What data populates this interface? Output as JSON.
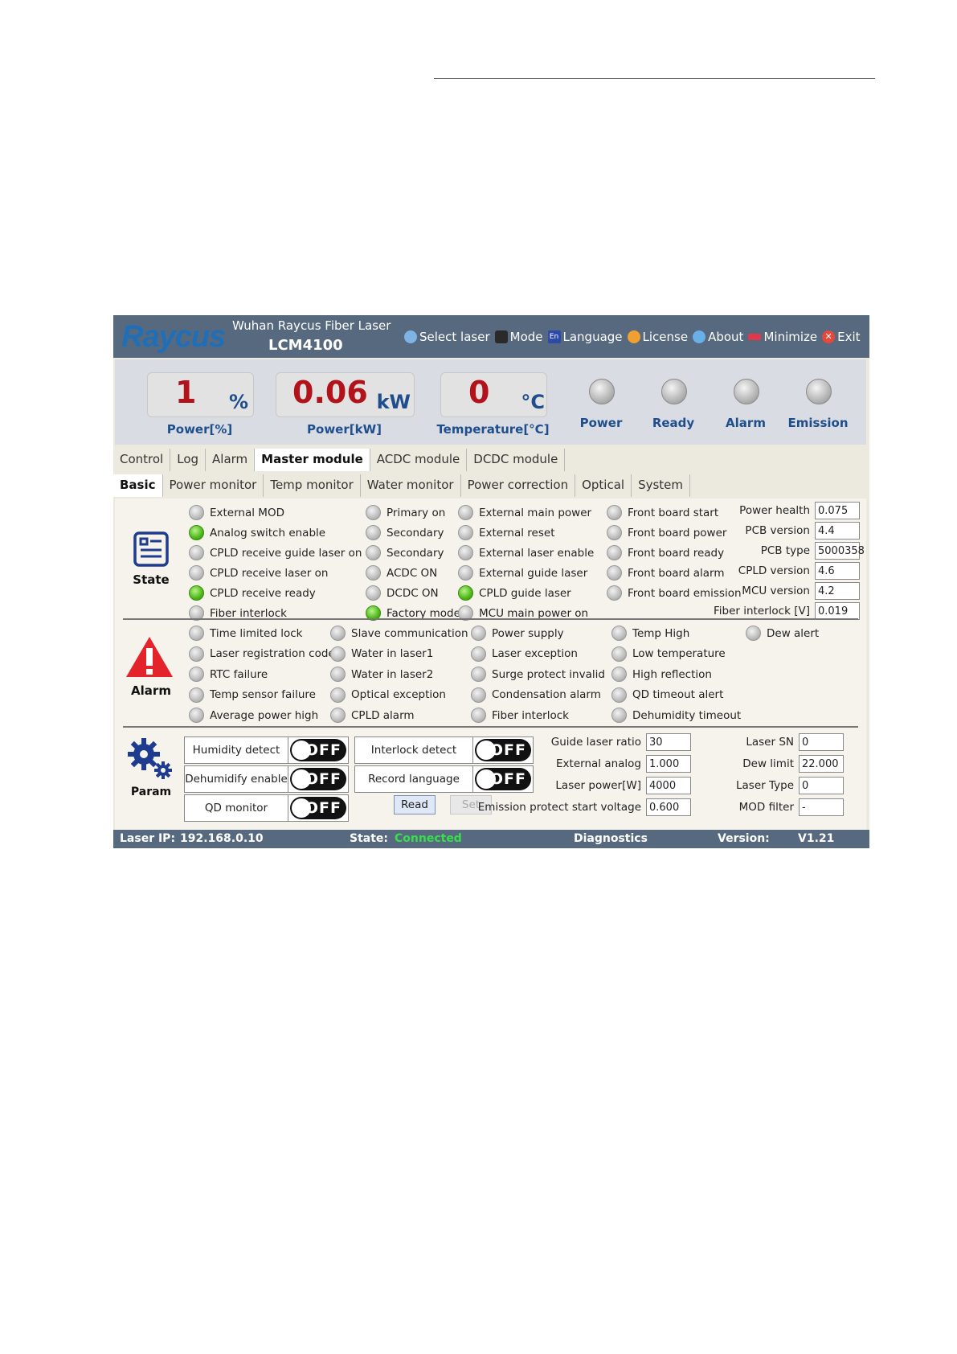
{
  "header": {
    "logo": "Raycus",
    "company": "Wuhan Raycus Fiber Laser",
    "model": "LCM4100",
    "menu": [
      {
        "label": "Select laser",
        "icon": "globe-icon"
      },
      {
        "label": "Mode",
        "icon": "users-icon"
      },
      {
        "label": "Language",
        "icon": "language-icon"
      },
      {
        "label": "License",
        "icon": "license-icon"
      },
      {
        "label": "About",
        "icon": "info-icon"
      },
      {
        "label": "Minimize",
        "icon": "minimize-icon"
      },
      {
        "label": "Exit",
        "icon": "exit-icon"
      }
    ]
  },
  "readouts": [
    {
      "value": "1",
      "unit": "%",
      "label": "Power[%]"
    },
    {
      "value": "0.06",
      "unit": "kW",
      "label": "Power[kW]"
    },
    {
      "value": "0",
      "unit": "°C",
      "label": "Temperature[°C]"
    }
  ],
  "indicators": [
    "Power",
    "Ready",
    "Alarm",
    "Emission"
  ],
  "tabs": [
    "Control",
    "Log",
    "Alarm",
    "Master module",
    "ACDC module",
    "DCDC module"
  ],
  "subtabs": [
    "Basic",
    "Power monitor",
    "Temp monitor",
    "Water monitor",
    "Power correction",
    "Optical",
    "System"
  ],
  "state": {
    "title": "State",
    "col1": [
      {
        "label": "External MOD",
        "on": false
      },
      {
        "label": "Analog switch enable",
        "on": true
      },
      {
        "label": "CPLD receive guide laser on",
        "on": false
      },
      {
        "label": "CPLD receive laser on",
        "on": false
      },
      {
        "label": "CPLD receive ready",
        "on": true
      },
      {
        "label": "Fiber interlock",
        "on": false
      }
    ],
    "col2": [
      {
        "label": "Primary on",
        "on": false
      },
      {
        "label": "Secondary",
        "on": false
      },
      {
        "label": "Secondary",
        "on": false
      },
      {
        "label": "ACDC ON",
        "on": false
      },
      {
        "label": "DCDC ON",
        "on": false
      },
      {
        "label": "Factory mode",
        "on": true
      }
    ],
    "col3": [
      {
        "label": "External main power",
        "on": false
      },
      {
        "label": "External reset",
        "on": false
      },
      {
        "label": "External laser enable",
        "on": false
      },
      {
        "label": "External guide laser",
        "on": false
      },
      {
        "label": "CPLD guide laser",
        "on": true
      },
      {
        "label": "MCU main power on",
        "on": false
      }
    ],
    "col4": [
      {
        "label": "Front board start",
        "on": false
      },
      {
        "label": "Front board power",
        "on": false
      },
      {
        "label": "Front board ready",
        "on": false
      },
      {
        "label": "Front board alarm",
        "on": false
      },
      {
        "label": "Front board emission",
        "on": false
      }
    ],
    "fields": [
      {
        "label": "Power health",
        "value": "0.075"
      },
      {
        "label": "PCB version",
        "value": "4.4"
      },
      {
        "label": "PCB type",
        "value": "5000358"
      },
      {
        "label": "CPLD version",
        "value": "4.6"
      },
      {
        "label": "MCU version",
        "value": "4.2"
      },
      {
        "label": "Fiber interlock [V]",
        "value": "0.019"
      }
    ]
  },
  "alarm": {
    "title": "Alarm",
    "col1": [
      "Time limited lock",
      "Laser registration code",
      "RTC failure",
      "Temp sensor failure",
      "Average power high"
    ],
    "col2": [
      "Slave communication",
      "Water in laser1",
      "Water in laser2",
      "Optical exception",
      "CPLD alarm"
    ],
    "col3": [
      "Power supply",
      "Laser exception",
      "Surge protect invalid",
      "Condensation alarm",
      "Fiber interlock"
    ],
    "col4": [
      "Temp High",
      "Low temperature",
      "High reflection",
      "QD timeout alert",
      "Dehumidity timeout"
    ],
    "col5": [
      "Dew alert"
    ]
  },
  "param": {
    "title": "Param",
    "toggles_left": [
      {
        "label": "Humidity detect",
        "state": "OFF"
      },
      {
        "label": "Dehumidify enable",
        "state": "OFF"
      },
      {
        "label": "QD monitor",
        "state": "OFF"
      }
    ],
    "toggles_mid": [
      {
        "label": "Interlock detect",
        "state": "OFF"
      },
      {
        "label": "Record language",
        "state": "OFF"
      }
    ],
    "read_label": "Read",
    "set_label": "Set",
    "fields_a": [
      {
        "label": "Guide laser ratio",
        "value": "30"
      },
      {
        "label": "External analog",
        "value": "1.000"
      },
      {
        "label": "Laser power[W]",
        "value": "4000"
      },
      {
        "label": "Emission protect start voltage",
        "value": "0.600"
      }
    ],
    "fields_b": [
      {
        "label": "Laser SN",
        "value": "0"
      },
      {
        "label": "Dew limit",
        "value": "22.000"
      },
      {
        "label": "Laser Type",
        "value": "0"
      },
      {
        "label": "MOD filter",
        "value": "-"
      }
    ]
  },
  "footer": {
    "ip_label": "Laser IP:",
    "ip": "192.168.0.10",
    "state_label": "State:",
    "state": "Connected",
    "diagnostics": "Diagnostics",
    "version_label": "Version:",
    "version": "V1.21"
  },
  "colors": {
    "header": "#57697e",
    "accent_blue": "#1f4e8c",
    "value_red": "#b2121a",
    "led_on": "#4db817",
    "connected": "#37e04b"
  }
}
